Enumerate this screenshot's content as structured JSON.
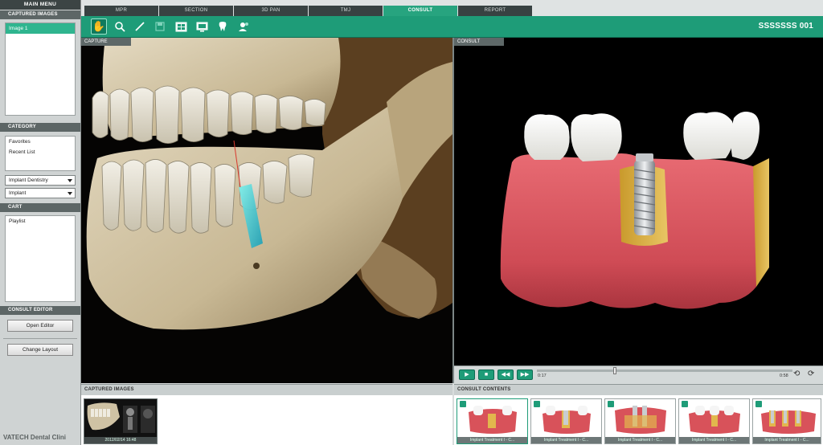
{
  "sidebar": {
    "main_menu": "MAIN MENU",
    "captured_images_title": "CAPTURED IMAGES",
    "captured_images": [
      "Image 1"
    ],
    "category_title": "CATEGORY",
    "category_items": [
      "Favorites",
      "Recent List"
    ],
    "category_select": "Implant Dentistry",
    "subcategory_select": "Implant",
    "cart_title": "CART",
    "cart_items": [
      "Playlist"
    ],
    "consult_editor_title": "CONSULT EDITOR",
    "open_editor": "Open Editor",
    "change_layout": "Change Layout",
    "footer": "VATECH Dental Clini"
  },
  "tabs": [
    {
      "label": "MPR",
      "active": false
    },
    {
      "label": "SECTION",
      "active": false
    },
    {
      "label": "3D PAN",
      "active": false
    },
    {
      "label": "TMJ",
      "active": false
    },
    {
      "label": "CONSULT",
      "active": true
    },
    {
      "label": "REPORT",
      "active": false
    }
  ],
  "toolbar": {
    "tools": [
      "hand-icon",
      "zoom-icon",
      "draw-icon",
      "save-icon",
      "gallery-icon",
      "monitor-icon",
      "tooth-icon",
      "doctor-icon"
    ],
    "patient_id": "SSSSSSS 001"
  },
  "panels": {
    "capture_title": "CAPTURE",
    "consult_title": "CONSULT"
  },
  "player": {
    "time_current": "0:17",
    "time_total": "0:58",
    "progress": 0.3
  },
  "captured_strip": {
    "title": "CAPTURED IMAGES",
    "thumb_caption": "2012/02/14 16:48"
  },
  "consult_strip": {
    "title": "CONSULT CONTENTS",
    "captions": [
      "Implant Treatment I - C...",
      "Implant Treatment I - C...",
      "Implant Treatment I - C...",
      "Implant Treatment I - C...",
      "Implant Treatment I - C..."
    ]
  },
  "colors": {
    "accent": "#1e9c78",
    "tab_dark": "#384242",
    "gum": "#d8525a",
    "bone": "#cfc2a4"
  }
}
